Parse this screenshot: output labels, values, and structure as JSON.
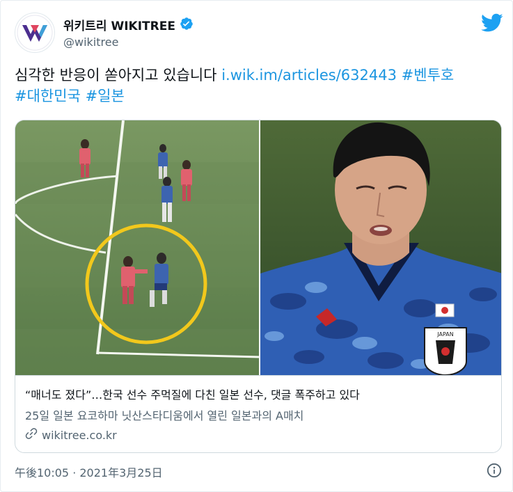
{
  "account": {
    "display_name": "위키트리 WIKITREE",
    "handle": "@wikitree",
    "verified": true
  },
  "tweet": {
    "text_plain": "심각한 반응이 쏟아지고 있습니다 ",
    "link": "i.wik.im/articles/632443",
    "hashtags": [
      "#벤투호",
      "#대한민국",
      "#일본"
    ]
  },
  "link_card": {
    "title": "“매너도 졌다”…한국 선수 주먹질에 다친 일본 선수, 댓글 폭주하고 있다",
    "description": "25일 일본 요코하마 닛산스타디움에서 열린 일본과의 A매치",
    "domain": "wikitree.co.kr"
  },
  "timestamp": "午後10:05 · 2021年3月25日",
  "icons": {
    "avatar": "wikitree-logo-icon",
    "verified": "verified-badge-icon",
    "brand": "twitter-bird-icon",
    "link": "link-icon",
    "info": "info-icon"
  },
  "colors": {
    "link_blue": "#1b95e0",
    "twitter_blue": "#1da1f2",
    "text_primary": "#0f1419",
    "text_secondary": "#536471",
    "highlight_circle": "#f2c81c"
  }
}
